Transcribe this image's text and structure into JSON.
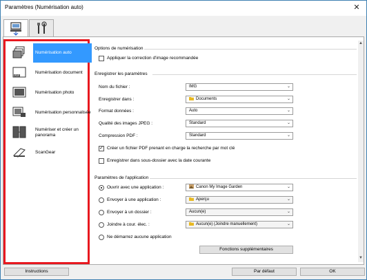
{
  "window": {
    "title": "Paramètres (Numérisation auto)",
    "close_glyph": "✕"
  },
  "tabs": [
    {
      "name": "scan-settings-tab"
    },
    {
      "name": "general-settings-tab"
    }
  ],
  "sidebar": {
    "items": [
      {
        "label": "Numérisation auto",
        "icon": "auto-scan-icon",
        "selected": true
      },
      {
        "label": "Numérisation document",
        "icon": "document-scan-icon"
      },
      {
        "label": "Numérisation photo",
        "icon": "photo-scan-icon"
      },
      {
        "label": "Numérisation personnalisée",
        "icon": "custom-scan-icon"
      },
      {
        "label": "Numériser et créer un panorama",
        "icon": "panorama-icon"
      },
      {
        "label": "ScanGear",
        "icon": "scangear-icon"
      }
    ]
  },
  "scan_options": {
    "title": "Options de numérisation",
    "apply_correction": "Appliquer la correction d'image recommandée"
  },
  "save_settings": {
    "title": "Enregistrer les paramètres",
    "filename_label": "Nom du fichier :",
    "filename_value": "IMG",
    "save_in_label": "Enregistrer dans :",
    "save_in_value": "Documents",
    "format_label": "Format données :",
    "format_value": "Auto",
    "jpeg_label": "Qualité des images JPEG :",
    "jpeg_value": "Standard",
    "pdf_label": "Compression PDF :",
    "pdf_value": "Standard",
    "searchable_pdf": "Créer un fichier PDF prenant en charge la recherche par mot clé",
    "subfolder": "Enregistrer dans sous-dossier avec la date courante"
  },
  "app_settings": {
    "title": "Paramètres de l'application",
    "open_app_label": "Ouvrir avec une application :",
    "open_app_value": "Canon My Image Garden",
    "send_app_label": "Envoyer à une application :",
    "send_app_value": "Aperçu",
    "send_folder_label": "Envoyer à un dossier :",
    "send_folder_value": "Aucun(e)",
    "email_label": "Joindre à cour. élec. :",
    "email_value": "Aucun(e) (Joindre manuellement)",
    "no_app_label": "Ne démarrez aucune application",
    "more_functions": "Fonctions supplémentaires"
  },
  "footer": {
    "instructions": "Instructions",
    "defaults": "Par défaut",
    "ok": "OK"
  },
  "colors": {
    "selection": "#3399ff",
    "highlight_border": "#e8181f",
    "window_border": "#3c7fb1"
  }
}
